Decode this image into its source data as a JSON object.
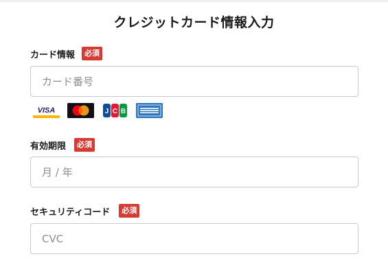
{
  "form": {
    "title": "クレジットカード情報入力",
    "required_badge": "必須",
    "card_number": {
      "label": "カード情報",
      "placeholder": "カード番号",
      "value": ""
    },
    "card_brands": [
      {
        "name": "VISA",
        "icon": "visa-icon"
      },
      {
        "name": "Mastercard",
        "icon": "mastercard-icon"
      },
      {
        "name": "JCB",
        "icon": "jcb-icon"
      },
      {
        "name": "American Express",
        "icon": "amex-icon"
      }
    ],
    "expiry": {
      "label": "有効期限",
      "placeholder": "月 / 年",
      "value": ""
    },
    "cvc": {
      "label": "セキュリティコード",
      "placeholder": "CVC",
      "value": ""
    }
  },
  "colors": {
    "required_badge_bg": "#d63a33",
    "input_border": "#c9c9c9"
  }
}
